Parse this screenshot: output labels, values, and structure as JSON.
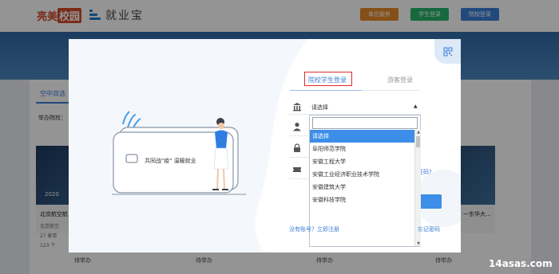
{
  "header": {
    "logo_text_a": "亮美",
    "logo_text_b": "校园",
    "product_name": "就业宝",
    "buttons": [
      {
        "label": "单位服务",
        "color": "#e6882a"
      },
      {
        "label": "学生登录",
        "color": "#27b36a"
      },
      {
        "label": "院校登录",
        "color": "#3b7fd6"
      }
    ]
  },
  "background": {
    "tab_label": "空中双选",
    "host_label": "举办院校：",
    "card_date": "2020",
    "card_title_left": "北京航空航",
    "card_sub_1": "北京航空",
    "card_sub_2": "27 家单",
    "card_sub_3": "123 个",
    "card_title_right": "一东华大...",
    "pending_labels": [
      "待举办",
      "待举办",
      "待举办",
      "待举办"
    ]
  },
  "modal": {
    "slogan": "共同战\"疫\" 温暖就业",
    "tabs": {
      "active": "院校学生登录",
      "guest": "游客登录"
    },
    "school_select": {
      "value": "请选择",
      "search_placeholder": ""
    },
    "dropdown_options": [
      "请选择",
      "阜阳师范学院",
      "安徽工程大学",
      "安徽工业经济职业技术学院",
      "安徽建筑大学",
      "安徽科技学院"
    ],
    "selected_index": 0,
    "verify_link": "证码?",
    "register_link": "没有账号？立即注册",
    "forgot_link": "忘记密码"
  },
  "watermark": "14asas.com",
  "colors": {
    "accent": "#3c8ee8",
    "highlight_box": "#e02a2a"
  },
  "icons": [
    "school-icon",
    "user-icon",
    "lock-icon",
    "ticket-icon",
    "qr-icon",
    "caret-down-icon"
  ]
}
